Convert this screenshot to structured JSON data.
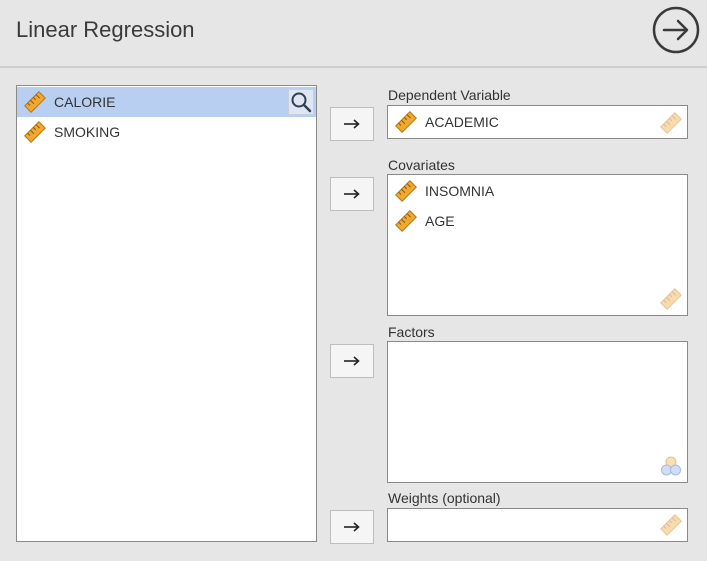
{
  "title": "Linear Regression",
  "source_list": {
    "items": [
      {
        "label": "CALORIE",
        "selected": true
      },
      {
        "label": "SMOKING",
        "selected": false
      }
    ]
  },
  "targets": {
    "dependent": {
      "label": "Dependent Variable",
      "items": [
        "ACADEMIC"
      ]
    },
    "covariates": {
      "label": "Covariates",
      "items": [
        "INSOMNIA",
        "AGE"
      ]
    },
    "factors": {
      "label": "Factors",
      "items": []
    },
    "weights": {
      "label": "Weights (optional)",
      "items": []
    }
  },
  "colors": {
    "background": "#e6e6e6",
    "selection": "#b8cff1",
    "ruler_icon": "#f0a830"
  },
  "icons": {
    "run": "circle-arrow-right-icon",
    "search": "magnifier-icon",
    "variable": "ruler-icon",
    "move": "arrow-right-icon",
    "factor_hint": "nominal-circles-icon"
  }
}
